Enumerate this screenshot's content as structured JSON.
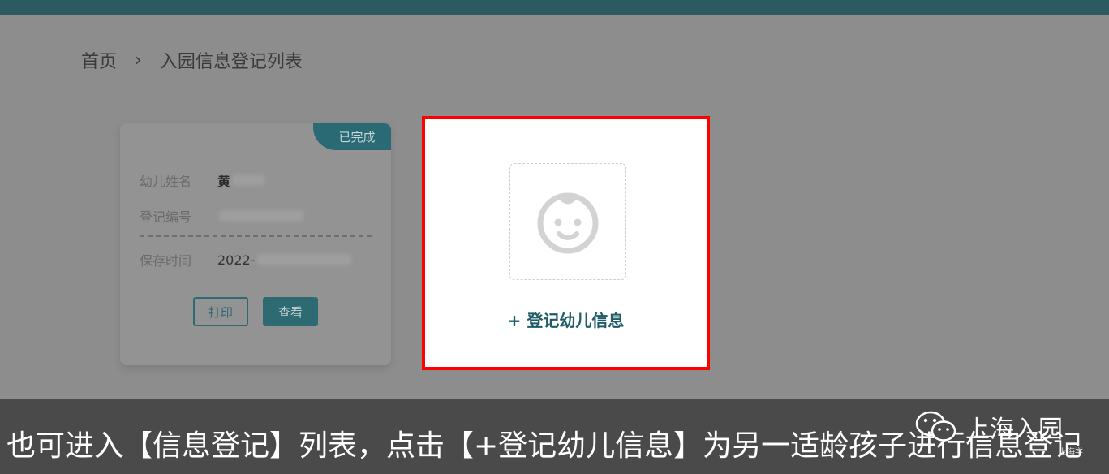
{
  "breadcrumb": {
    "home": "首页",
    "separator": "›",
    "current": "入园信息登记列表"
  },
  "card": {
    "status_badge": "已完成",
    "fields": [
      {
        "label": "幼儿姓名",
        "value": "黄"
      },
      {
        "label": "登记编号",
        "value": ""
      },
      {
        "label": "保存时间",
        "value": "2022-"
      }
    ],
    "print_button": "打印",
    "view_button": "查看"
  },
  "add_card": {
    "label": "+ 登记幼儿信息",
    "icon": "baby-face-icon"
  },
  "subtitle": "也可进入【信息登记】列表，点击【+登记幼儿信息】为另一适龄孩子进行信息登记",
  "watermark": {
    "text": "上海入园",
    "sub": "上海学",
    "icon": "wechat-icon"
  },
  "colors": {
    "teal": "#2e6a72",
    "highlight": "#ff0000",
    "topbar": "#2d5a60"
  }
}
